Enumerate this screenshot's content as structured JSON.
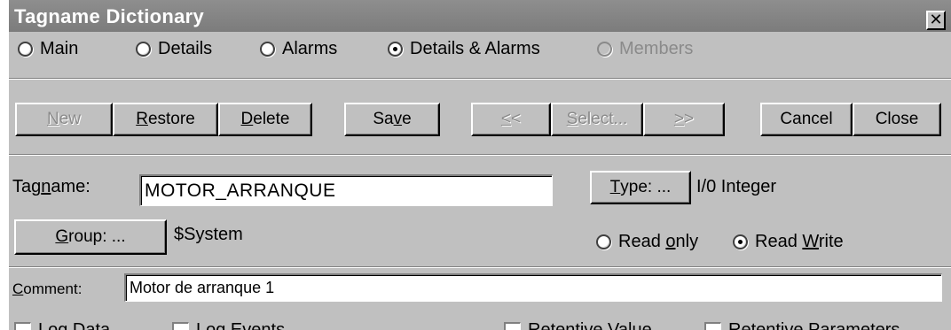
{
  "window": {
    "title": "Tagname Dictionary",
    "close_glyph": "✕"
  },
  "view_options": [
    {
      "label": "Main",
      "selected": false,
      "disabled": false
    },
    {
      "label": "Details",
      "selected": false,
      "disabled": false
    },
    {
      "label": "Alarms",
      "selected": false,
      "disabled": false
    },
    {
      "label": "Details & Alarms",
      "selected": true,
      "disabled": false
    },
    {
      "label": "Members",
      "selected": false,
      "disabled": true
    }
  ],
  "toolbar": {
    "new": {
      "pre": "",
      "accel": "N",
      "post": "ew"
    },
    "restore": {
      "pre": "",
      "accel": "R",
      "post": "estore"
    },
    "delete": {
      "pre": "",
      "accel": "D",
      "post": "elete"
    },
    "save": {
      "pre": "Sa",
      "accel": "v",
      "post": "e"
    },
    "prev": {
      "pre": "",
      "accel": "<",
      "post": "<"
    },
    "select": {
      "pre": "",
      "accel": "S",
      "post": "elect..."
    },
    "next": {
      "pre": "",
      "accel": ">",
      "post": ">"
    },
    "cancel": "Cancel",
    "close": "Close"
  },
  "tagname": {
    "pre": "Tag",
    "accel": "n",
    "post": "ame:",
    "value": "MOTOR_ARRANQUE"
  },
  "type": {
    "pre": "",
    "accel": "T",
    "post": "ype: ...",
    "value": "I/0 Integer"
  },
  "group": {
    "pre": "",
    "accel": "G",
    "post": "roup: ...",
    "value": "$System"
  },
  "access": {
    "read_only": {
      "pre": "Read ",
      "accel": "o",
      "post": "nly",
      "selected": false
    },
    "read_write": {
      "pre": "Read ",
      "accel": "W",
      "post": "rite",
      "selected": true
    }
  },
  "comment": {
    "pre": "",
    "accel": "C",
    "post": "omment:",
    "value": "Motor de arranque 1"
  },
  "options": [
    {
      "label": "Log Data",
      "checked": false
    },
    {
      "label": "Log Events",
      "checked": false
    },
    {
      "label": "Retentive Value",
      "checked": false
    },
    {
      "label": "Retentive Parameters",
      "checked": false
    }
  ]
}
